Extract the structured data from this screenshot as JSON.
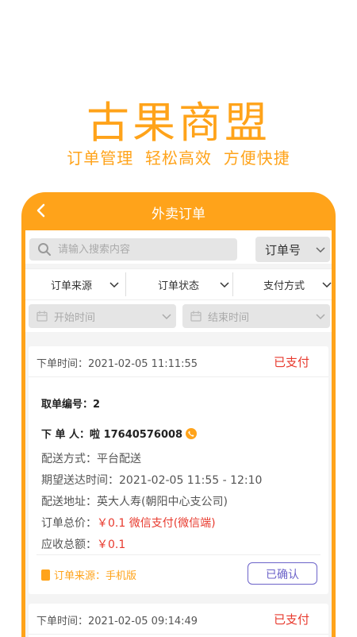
{
  "hero": {
    "title": "古果商盟",
    "subtitle": "订单管理  轻松高效  方便快捷"
  },
  "header": {
    "title": "外卖订单"
  },
  "search": {
    "placeholder": "请输入搜索内容",
    "type_select": "订单号"
  },
  "filters": [
    {
      "label": "订单来源"
    },
    {
      "label": "订单状态"
    },
    {
      "label": "支付方式"
    }
  ],
  "dates": {
    "start": "开始时间",
    "end": "结束时间"
  },
  "orders": [
    {
      "order_time": "下单时间：2021-02-05 11:11:55",
      "status": "已支付",
      "pickup_no": "取单编号：2",
      "customer": "下 单 人：啦 17640576008",
      "delivery_method": "配送方式：平台配送",
      "expected_time": "期望送达时间：2021-02-05 11:55 - 12:10",
      "address": "配送地址：英大人寿(朝阳中心支公司)",
      "total_label": "订单总价：",
      "total_value": "￥0.1 微信支付(微信端)",
      "receivable_label": "应收总额：",
      "receivable_value": "￥0.1",
      "source": "订单来源：手机版",
      "action": "已确认"
    },
    {
      "order_time": "下单时间：2021-02-05 09:14:49",
      "status": "已支付"
    }
  ],
  "colors": {
    "brand": "#FFA31A",
    "paid": "#E83A2E",
    "confirm": "#6C63C9"
  }
}
